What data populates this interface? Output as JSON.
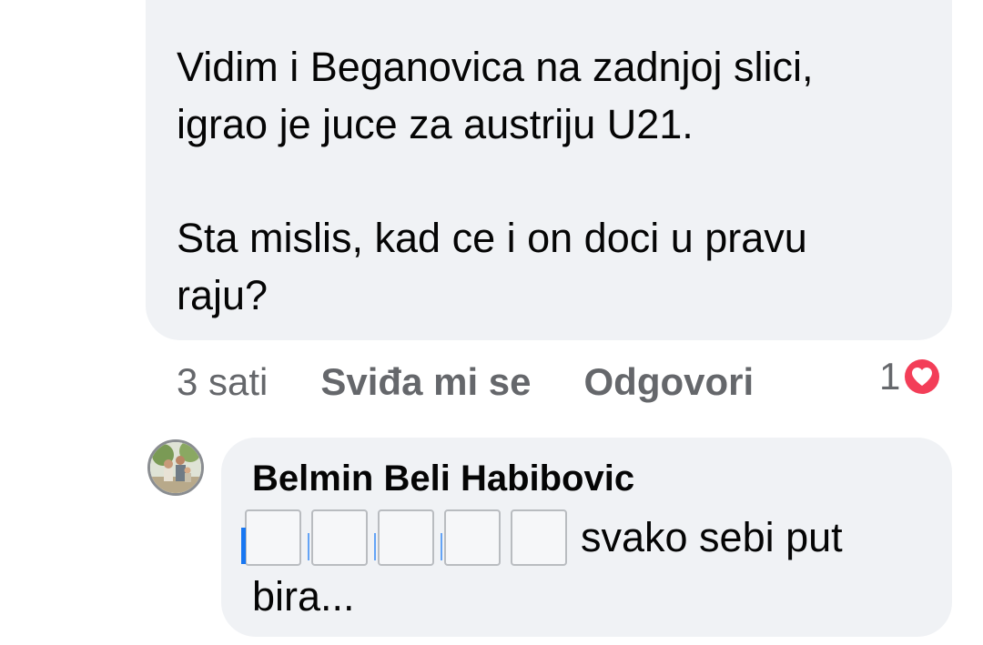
{
  "comment_1": {
    "paragraph_1_line_1": "Vidim i Beganovica na zadnjoj slici,",
    "paragraph_1_line_2": "igrao je juce za austriju U21.",
    "paragraph_2_line_1": "Sta mislis, kad ce i on doci u pravu",
    "paragraph_2_line_2": "raju?"
  },
  "comment_1_actions": {
    "time": "3 sati",
    "like_label": "Sviđa mi se",
    "reply_label": "Odgovori",
    "reaction_count": "1",
    "reaction_icon": "heart-icon",
    "reaction_color": "#f33e58"
  },
  "comment_2": {
    "author": "Belmin Beli Habibovic",
    "text_after_emoji": "svako sebi put",
    "text_line_2": "bira..."
  },
  "colors": {
    "bubble_bg": "#f0f2f5",
    "meta_text": "#65676b",
    "link_blue": "#1877f2"
  }
}
